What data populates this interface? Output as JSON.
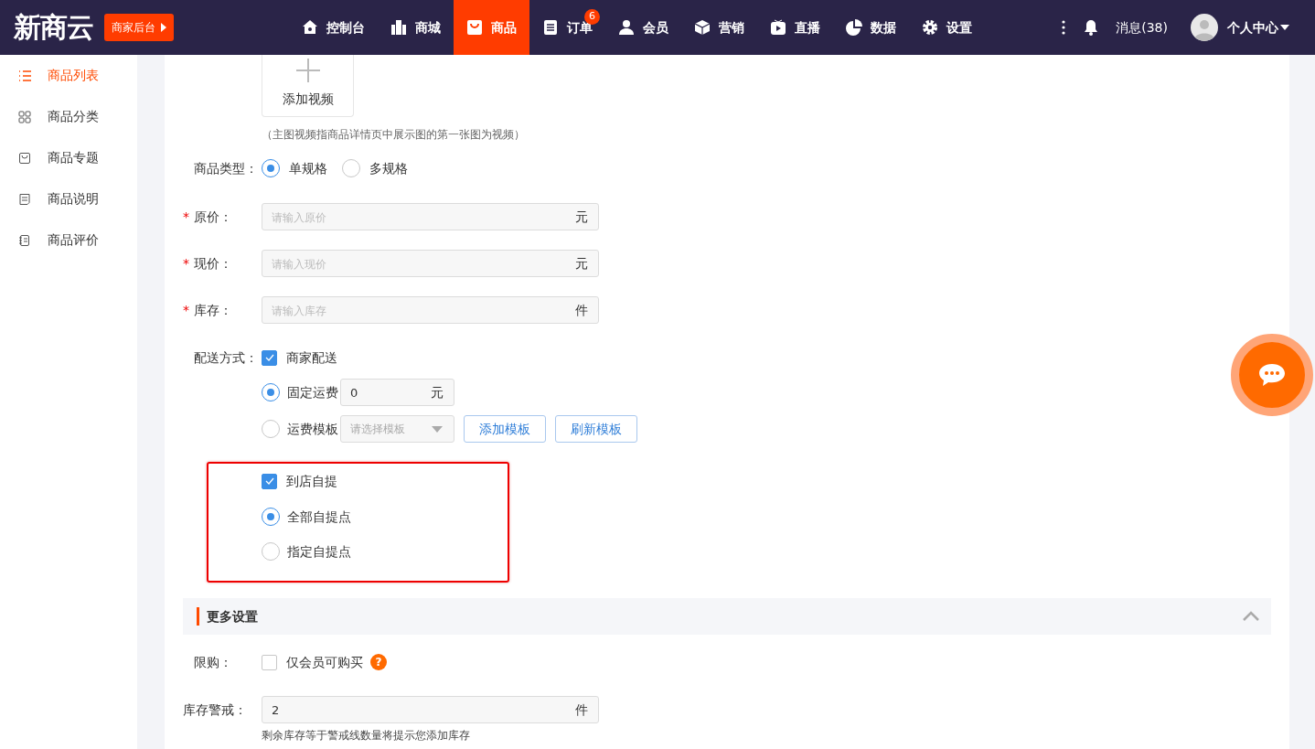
{
  "header": {
    "logo": "新商云",
    "merchant_button": "商家后台",
    "nav": [
      {
        "label": "控制台",
        "selected": false
      },
      {
        "label": "商城",
        "selected": false
      },
      {
        "label": "商品",
        "selected": true
      },
      {
        "label": "订单",
        "selected": false,
        "badge": "6"
      },
      {
        "label": "会员",
        "selected": false
      },
      {
        "label": "营销",
        "selected": false
      },
      {
        "label": "直播",
        "selected": false
      },
      {
        "label": "数据",
        "selected": false
      },
      {
        "label": "设置",
        "selected": false
      }
    ],
    "messages": "消息(38)",
    "user": "个人中心"
  },
  "sidebar": {
    "items": [
      {
        "label": "商品列表",
        "selected": true
      },
      {
        "label": "商品分类",
        "selected": false
      },
      {
        "label": "商品专题",
        "selected": false
      },
      {
        "label": "商品说明",
        "selected": false
      },
      {
        "label": "商品评价",
        "selected": false
      }
    ]
  },
  "form": {
    "video_upload": "添加视频",
    "video_note": "（主图视频指商品详情页中展示图的第一张图为视频）",
    "product_type": {
      "label": "商品类型：",
      "options": [
        {
          "label": "单规格",
          "selected": true
        },
        {
          "label": "多规格",
          "selected": false
        }
      ]
    },
    "price_fields": [
      {
        "required_mark": "*",
        "label": "原价：",
        "placeholder": "请输入原价",
        "unit": "元"
      },
      {
        "required_mark": "*",
        "label": "现价：",
        "placeholder": "请输入现价",
        "unit": "元"
      },
      {
        "required_mark": "*",
        "label": "库存：",
        "placeholder": "请输入库存",
        "unit": "件"
      }
    ],
    "delivery": {
      "label": "配送方式：",
      "merchant_delivery": {
        "label": "商家配送",
        "checked": true
      },
      "fee_options": [
        {
          "kind": "fixed",
          "label": "固定运费",
          "selected": true,
          "value": "0",
          "unit": "元"
        },
        {
          "kind": "template",
          "label": "运费模板",
          "selected": false,
          "placeholder": "请选择模板",
          "buttons": [
            "添加模板",
            "刷新模板"
          ]
        }
      ]
    },
    "pickup": {
      "label": "到店自提",
      "checked": true,
      "options": [
        {
          "label": "全部自提点",
          "selected": true
        },
        {
          "label": "指定自提点",
          "selected": false
        }
      ]
    },
    "more_settings": {
      "title": "更多设置",
      "expanded": true
    },
    "purchase_limit": {
      "label": "限购：",
      "option": "仅会员可购买",
      "checked": false,
      "help_icon": "?"
    },
    "stock_warning": {
      "label": "库存警戒：",
      "value": "2",
      "unit": "件",
      "hint": "剩余库存等于警戒线数量将提示您添加库存"
    }
  }
}
